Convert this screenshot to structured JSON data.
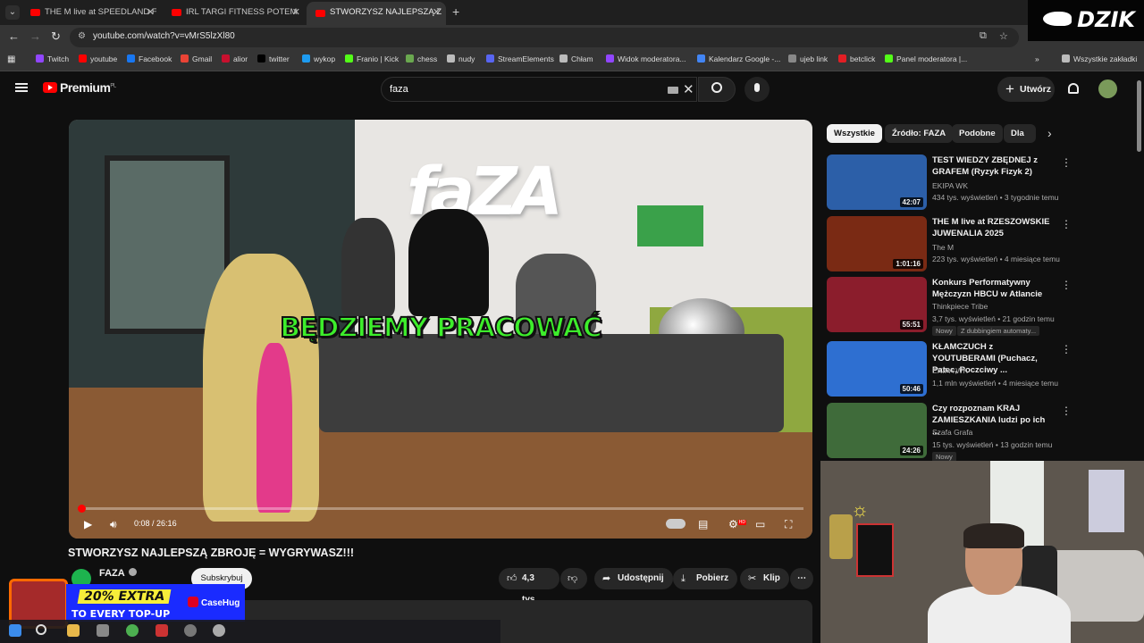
{
  "browser": {
    "tabs": [
      {
        "title": "THE M live at SPEEDLAND FEST"
      },
      {
        "title": "IRL TARGI FITNESS POTEM SPO"
      },
      {
        "title": "STWORZYSZ NAJLEPSZĄ ZBROJ"
      }
    ],
    "url": "youtube.com/watch?v=vMrS5lzXl80",
    "bookmarks": [
      "Twitch",
      "youtube",
      "Facebook",
      "Gmail",
      "alior",
      "twitter",
      "wykop",
      "Franio | Kick",
      "chess",
      "nudy",
      "StreamElements",
      "Chłam",
      "Widok moderatora...",
      "Kalendarz Google -...",
      "ujeb link",
      "betclick",
      "Panel moderatora |..."
    ],
    "bookmark_colors": [
      "#9146ff",
      "#ff0000",
      "#1877f2",
      "#ea4335",
      "#c8102e",
      "#000000",
      "#1d9bf0",
      "#53fc18",
      "#6aa84f",
      "#bbbbbb",
      "#5865f2",
      "#bbbbbb",
      "#9146ff",
      "#4285f4",
      "#888888",
      "#e31e24",
      "#53fc18"
    ],
    "all_bookmarks": "Wszystkie zakładki"
  },
  "overlay": {
    "stream_brand": "DZIK"
  },
  "youtube": {
    "logo": "Premium",
    "logo_region": "PL",
    "search_value": "faza",
    "create_label": "Utwórz"
  },
  "player": {
    "caption": "BĘDZIEMY PRACOWAĆ",
    "wall_logo": "faZA",
    "time_current": "0:08",
    "time_total": "26:16",
    "progress_fraction": 0.005,
    "hd_badge": "HD"
  },
  "video": {
    "title": "STWORZYSZ NAJLEPSZĄ ZBROJĘ = WYGRYWASZ!!!",
    "channel": "FAZA",
    "subscribe_label": "Subskrybuj",
    "likes": "4,3 tys.",
    "share_label": "Udostępnij",
    "download_label": "Pobierz",
    "clip_label": "Klip"
  },
  "chips": [
    "Wszystkie",
    "Źródło: FAZA",
    "Podobne",
    "Dla Ci"
  ],
  "recommendations": [
    {
      "title": "TEST WIEDZY ZBĘDNEJ z GRAFEM (Ryzyk Fizyk 2)",
      "channel": "EKIPA WK",
      "meta": "434 tys. wyświetleń • 3 tygodnie temu",
      "duration": "42:07",
      "thumb": "#2c5fa8",
      "badges": []
    },
    {
      "title": "THE M live at RZESZOWSKIE JUWENALIA 2025",
      "channel": "The M",
      "meta": "223 tys. wyświetleń • 4 miesiące temu",
      "duration": "1:01:16",
      "thumb": "#7a2a14",
      "badges": []
    },
    {
      "title": "Konkurs Performatywny Mężczyzn HBCU w Atlancie",
      "channel": "Thinkpiece Tribe",
      "meta": "3,7 tys. wyświetleń • 21 godzin temu",
      "duration": "55:51",
      "thumb": "#8b1d2c",
      "badges": [
        "Nowy",
        "Z dubbingiem automaty..."
      ]
    },
    {
      "title": "KŁAMCZUCH z YOUTUBERAMI (Puchacz, Patec, Poczciwy ...",
      "channel": "EKIPA WK",
      "meta": "1,1 mln wyświetleń • 4 miesiące temu",
      "duration": "50:46",
      "thumb": "#2e6fd1",
      "badges": []
    },
    {
      "title": "Czy rozpoznam KRAJ ZAMIESZKANIA ludzi po ich ...",
      "channel": "Szafa Grafa",
      "meta": "15 tys. wyświetleń • 13 godzin temu",
      "duration": "24:26",
      "thumb": "#3f6b3a",
      "badges": [
        "Nowy"
      ]
    }
  ],
  "ad": {
    "headline": "20% EXTRA",
    "subline": "TO EVERY TOP-UP",
    "brand": "CaseHug"
  }
}
